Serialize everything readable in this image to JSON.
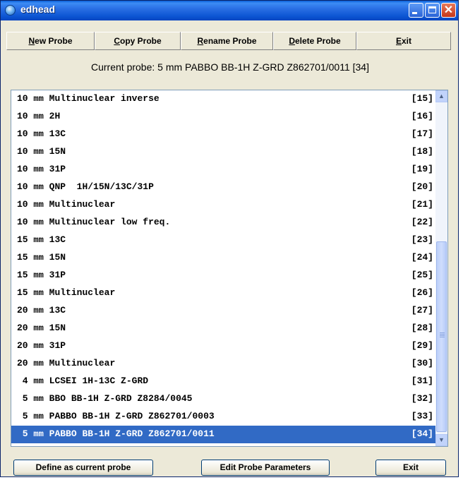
{
  "window": {
    "title": "edhead"
  },
  "toolbar": {
    "new_probe": {
      "key": "N",
      "rest": "ew Probe"
    },
    "copy_probe": {
      "key": "C",
      "rest": "opy Probe"
    },
    "rename_probe": {
      "key": "R",
      "rest": "ename Probe"
    },
    "delete_probe": {
      "key": "D",
      "rest": "elete Probe"
    },
    "exit": {
      "key": "E",
      "rest": "xit"
    }
  },
  "current_probe": "Current probe: 5 mm PABBO BB-1H Z-GRD Z862701/0011 [34]",
  "probes": [
    {
      "size": "10",
      "unit": "mm",
      "desc": "Multinuclear inverse",
      "index": "[15]"
    },
    {
      "size": "10",
      "unit": "mm",
      "desc": "2H",
      "index": "[16]"
    },
    {
      "size": "10",
      "unit": "mm",
      "desc": "13C",
      "index": "[17]"
    },
    {
      "size": "10",
      "unit": "mm",
      "desc": "15N",
      "index": "[18]"
    },
    {
      "size": "10",
      "unit": "mm",
      "desc": "31P",
      "index": "[19]"
    },
    {
      "size": "10",
      "unit": "mm",
      "desc": "QNP  1H/15N/13C/31P",
      "index": "[20]"
    },
    {
      "size": "10",
      "unit": "mm",
      "desc": "Multinuclear",
      "index": "[21]"
    },
    {
      "size": "10",
      "unit": "mm",
      "desc": "Multinuclear low freq.",
      "index": "[22]"
    },
    {
      "size": "15",
      "unit": "mm",
      "desc": "13C",
      "index": "[23]"
    },
    {
      "size": "15",
      "unit": "mm",
      "desc": "15N",
      "index": "[24]"
    },
    {
      "size": "15",
      "unit": "mm",
      "desc": "31P",
      "index": "[25]"
    },
    {
      "size": "15",
      "unit": "mm",
      "desc": "Multinuclear",
      "index": "[26]"
    },
    {
      "size": "20",
      "unit": "mm",
      "desc": "13C",
      "index": "[27]"
    },
    {
      "size": "20",
      "unit": "mm",
      "desc": "15N",
      "index": "[28]"
    },
    {
      "size": "20",
      "unit": "mm",
      "desc": "31P",
      "index": "[29]"
    },
    {
      "size": "20",
      "unit": "mm",
      "desc": "Multinuclear",
      "index": "[30]"
    },
    {
      "size": " 4",
      "unit": "mm",
      "desc": "LCSEI 1H-13C Z-GRD",
      "index": "[31]"
    },
    {
      "size": " 5",
      "unit": "mm",
      "desc": "BBO BB-1H Z-GRD Z8284/0045",
      "index": "[32]"
    },
    {
      "size": " 5",
      "unit": "mm",
      "desc": "PABBO BB-1H Z-GRD Z862701/0003",
      "index": "[33]"
    },
    {
      "size": " 5",
      "unit": "mm",
      "desc": "PABBO BB-1H Z-GRD Z862701/0011",
      "index": "[34]",
      "selected": true
    }
  ],
  "buttons": {
    "define": "Define as current probe",
    "edit": "Edit Probe Parameters",
    "exit": "Exit"
  },
  "icons": {
    "title": "app-icon",
    "minimize": "minimize-icon",
    "maximize": "maximize-icon",
    "close": "close-icon",
    "scroll_up": "scroll-up-icon",
    "scroll_down": "scroll-down-icon"
  }
}
